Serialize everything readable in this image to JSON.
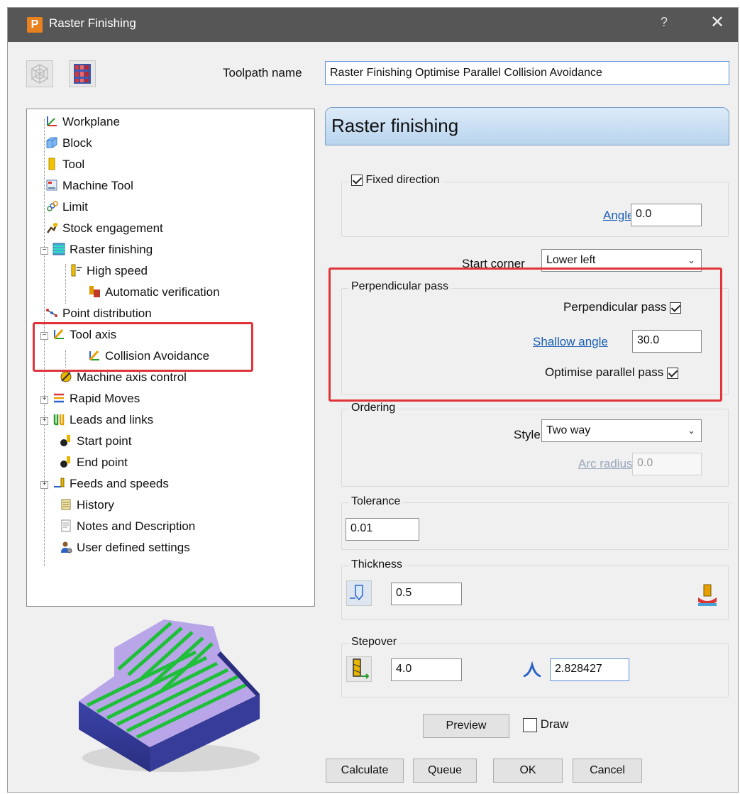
{
  "window": {
    "title": "Raster Finishing",
    "app_icon_letter": "P",
    "help": "?",
    "close": "✕"
  },
  "toolpath_name": {
    "label": "Toolpath name",
    "value": "Raster Finishing Optimise Parallel Collision Avoidance"
  },
  "tree": {
    "items": [
      {
        "label": "Workplane",
        "icon": "workplane-icon"
      },
      {
        "label": "Block",
        "icon": "block-icon"
      },
      {
        "label": "Tool",
        "icon": "tool-icon"
      },
      {
        "label": "Machine Tool",
        "icon": "machine-tool-icon"
      },
      {
        "label": "Limit",
        "icon": "limit-icon"
      },
      {
        "label": "Stock engagement",
        "icon": "stock-engagement-icon"
      },
      {
        "label": "Raster finishing",
        "icon": "raster-finishing-icon",
        "expander": "−"
      },
      {
        "label": "High speed",
        "icon": "high-speed-icon"
      },
      {
        "label": "Automatic verification",
        "icon": "automatic-verification-icon"
      },
      {
        "label": "Point distribution",
        "icon": "point-distribution-icon"
      },
      {
        "label": "Tool axis",
        "icon": "tool-axis-icon",
        "expander": "−"
      },
      {
        "label": "Collision Avoidance",
        "icon": "collision-avoidance-icon"
      },
      {
        "label": "Machine axis control",
        "icon": "machine-axis-control-icon"
      },
      {
        "label": "Rapid Moves",
        "icon": "rapid-moves-icon",
        "expander": "+"
      },
      {
        "label": "Leads and links",
        "icon": "leads-links-icon",
        "expander": "+"
      },
      {
        "label": "Start point",
        "icon": "start-point-icon"
      },
      {
        "label": "End point",
        "icon": "end-point-icon"
      },
      {
        "label": "Feeds and speeds",
        "icon": "feeds-speeds-icon",
        "expander": "+"
      },
      {
        "label": "History",
        "icon": "history-icon"
      },
      {
        "label": "Notes and Description",
        "icon": "notes-icon"
      },
      {
        "label": "User defined settings",
        "icon": "user-settings-icon"
      }
    ]
  },
  "panel": {
    "header": "Raster finishing",
    "fixed_direction": {
      "label": "Fixed direction",
      "checked": true
    },
    "angle": {
      "label": "Angle",
      "value": "0.0"
    },
    "start_corner": {
      "label": "Start corner",
      "value": "Lower left"
    },
    "perpendicular": {
      "legend": "Perpendicular pass",
      "pass_label": "Perpendicular pass",
      "pass_checked": true,
      "shallow_label": "Shallow angle",
      "shallow_value": "30.0",
      "optimise_label": "Optimise parallel pass",
      "optimise_checked": true
    },
    "ordering": {
      "legend": "Ordering",
      "style_label": "Style",
      "style_value": "Two way",
      "arc_label": "Arc radius",
      "arc_value": "0.0"
    },
    "tolerance": {
      "legend": "Tolerance",
      "value": "0.01"
    },
    "thickness": {
      "legend": "Thickness",
      "value": "0.5"
    },
    "stepover": {
      "legend": "Stepover",
      "value": "4.0",
      "cusp_value": "2.828427"
    }
  },
  "preview": {
    "label": "Preview",
    "draw_label": "Draw"
  },
  "buttons": {
    "calculate": "Calculate",
    "queue": "Queue",
    "ok": "OK",
    "cancel": "Cancel"
  },
  "colors": {
    "highlight_red": "#e0343b",
    "link_blue": "#1a5fb4",
    "header_blue": "#b9d4ee"
  }
}
